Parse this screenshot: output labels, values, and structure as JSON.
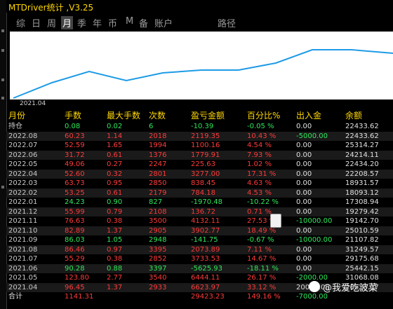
{
  "window": {
    "title": "MTDriver统计 ,V3.25"
  },
  "tabs": [
    "综",
    "日",
    "周",
    "月",
    "季",
    "年",
    "币",
    "M",
    "备",
    "账户",
    "路径"
  ],
  "chart": {
    "x_label": "2021.04",
    "line_color": "#1e9be6"
  },
  "table": {
    "headers": [
      "月份",
      "手数",
      "最大手数",
      "次数",
      "盈亏金额",
      "百分比%",
      "出入金",
      "余额"
    ],
    "rows": [
      [
        "持仓",
        "0.08",
        "0.02",
        "6",
        "-10.39",
        "-0.05 %",
        "0.00",
        "22433.62"
      ],
      [
        "2022.08",
        "60.23",
        "1.14",
        "2018",
        "2119.35",
        "10.43 %",
        "-5000.00",
        "22433.62"
      ],
      [
        "2022.07",
        "52.59",
        "1.65",
        "1994",
        "1100.16",
        "4.54 %",
        "0.00",
        "25314.27"
      ],
      [
        "2022.06",
        "31.72",
        "0.61",
        "1376",
        "1779.91",
        "7.93 %",
        "0.00",
        "24214.11"
      ],
      [
        "2022.05",
        "49.06",
        "0.27",
        "2247",
        "225.63",
        "1.02 %",
        "0.00",
        "22434.20"
      ],
      [
        "2022.04",
        "52.60",
        "0.32",
        "2801",
        "3277.00",
        "17.31 %",
        "0.00",
        "22208.57"
      ],
      [
        "2022.03",
        "63.73",
        "0.95",
        "2850",
        "838.45",
        "4.63 %",
        "0.00",
        "18931.57"
      ],
      [
        "2022.02",
        "53.25",
        "0.61",
        "2179",
        "784.18",
        "4.53 %",
        "0.00",
        "18093.12"
      ],
      [
        "2022.01",
        "24.23",
        "0.90",
        "827",
        "-1970.48",
        "-10.22 %",
        "0.00",
        "17308.94"
      ],
      [
        "2021.12",
        "55.99",
        "0.79",
        "2108",
        "136.72",
        "0.71 %",
        "0.00",
        "19279.42"
      ],
      [
        "2021.11",
        "76.63",
        "0.38",
        "3500",
        "4132.11",
        "27.53 %",
        "-10000.00",
        "19142.70"
      ],
      [
        "2021.10",
        "82.89",
        "1.37",
        "2905",
        "3902.77",
        "18.49 %",
        "0.00",
        "25010.59"
      ],
      [
        "2021.09",
        "86.03",
        "1.05",
        "2948",
        "-141.75",
        "-0.67 %",
        "-10000.00",
        "21107.82"
      ],
      [
        "2021.08",
        "86.46",
        "0.97",
        "3395",
        "2073.89",
        "7.11 %",
        "0.00",
        "31249.57"
      ],
      [
        "2021.07",
        "55.29",
        "0.38",
        "2852",
        "3733.53",
        "14.67 %",
        "0.00",
        "29175.68"
      ],
      [
        "2021.06",
        "90.28",
        "0.88",
        "3397",
        "-5625.93",
        "-18.11 %",
        "0.00",
        "25442.15"
      ],
      [
        "2021.05",
        "123.80",
        "2.77",
        "3540",
        "6444.11",
        "26.17 %",
        "-2000.00",
        "31068.08"
      ],
      [
        "2021.04",
        "96.45",
        "1.37",
        "2933",
        "6623.97",
        "33.12 %",
        "20000.00",
        "26623.97"
      ]
    ],
    "total": [
      "合计",
      "1141.31",
      "",
      "",
      "29423.23",
      "149.16 %",
      "-7000.00",
      ""
    ]
  },
  "watermark": {
    "text": "@我爱吃波菜"
  }
}
